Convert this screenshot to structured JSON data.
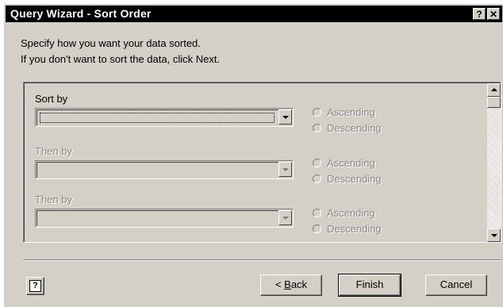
{
  "window": {
    "title": "Query Wizard - Sort Order",
    "help_glyph": "?",
    "close_glyph": "✕"
  },
  "instructions": {
    "line1": "Specify how you want your data sorted.",
    "line2": "If you don't want to sort the data, click Next."
  },
  "sort_rows": [
    {
      "label": "Sort by",
      "value": "",
      "enabled": true,
      "asc": "Ascending",
      "desc": "Descending"
    },
    {
      "label": "Then by",
      "value": "",
      "enabled": false,
      "asc": "Ascending",
      "desc": "Descending"
    },
    {
      "label": "Then by",
      "value": "",
      "enabled": false,
      "asc": "Ascending",
      "desc": "Descending"
    }
  ],
  "buttons": {
    "help_icon": "question-icon",
    "back_prefix": "< ",
    "back_label": "Back",
    "back_mnemonic": "B",
    "finish_label": "Finish",
    "cancel_label": "Cancel"
  }
}
